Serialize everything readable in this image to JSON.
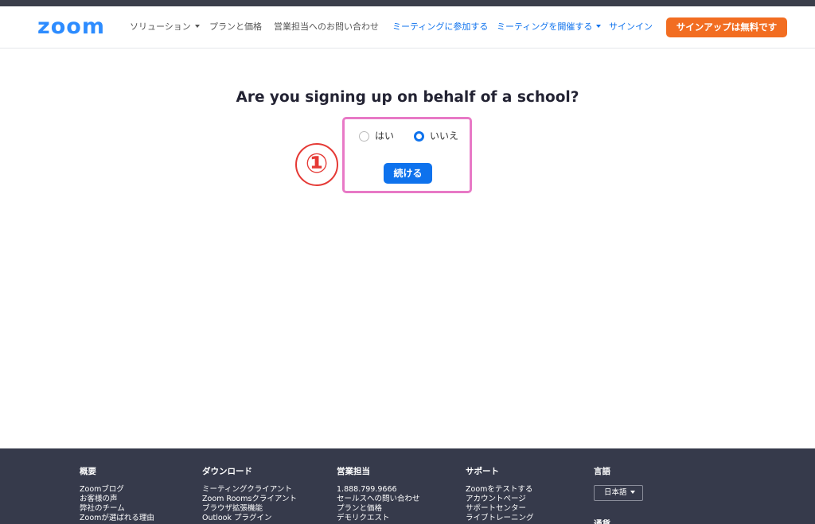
{
  "header": {
    "logo": "zoom",
    "nav": {
      "solutions": "ソリューション",
      "plans": "プランと価格",
      "contact_sales": "営業担当へのお問い合わせ",
      "join_meeting": "ミーティングに参加する",
      "host_meeting": "ミーティングを開催する",
      "sign_in": "サインイン",
      "sign_up": "サインアップは無料です"
    },
    "colors": {
      "brand": "#2d8cff",
      "link": "#0e72ed",
      "signup": "#f26d21"
    }
  },
  "main": {
    "question": "Are you signing up on behalf of a school?",
    "options": [
      {
        "label": "はい",
        "checked": false
      },
      {
        "label": "いいえ",
        "checked": true
      }
    ],
    "continue_label": "続ける",
    "step_marker": "①",
    "colors": {
      "highlight": "#e879c6",
      "marker": "#e53935"
    }
  },
  "footer": {
    "columns": [
      {
        "heading": "概要",
        "links": [
          "Zoomブログ",
          "お客様の声",
          "弊社のチーム",
          "Zoomが選ばれる理由"
        ]
      },
      {
        "heading": "ダウンロード",
        "links": [
          "ミーティングクライアント",
          "Zoom Roomsクライアント",
          "ブラウザ拡張機能",
          "Outlook プラグイン"
        ]
      },
      {
        "heading": "営業担当",
        "links": [
          "1.888.799.9666",
          "セールスへの問い合わせ",
          "プランと価格",
          "デモリクエスト"
        ]
      },
      {
        "heading": "サポート",
        "links": [
          "Zoomをテストする",
          "アカウントページ",
          "サポートセンター",
          "ライブトレーニング"
        ]
      }
    ],
    "language": {
      "heading": "言語",
      "selected": "日本語"
    },
    "currency_heading": "通貨",
    "background": "#363a4b"
  }
}
